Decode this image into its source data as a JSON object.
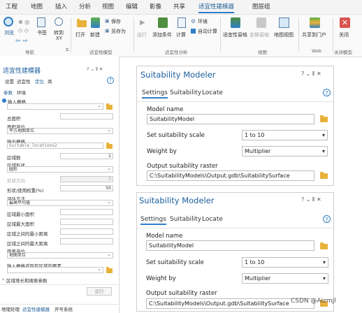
{
  "ribbon": {
    "tabs": [
      "工程",
      "地图",
      "插入",
      "分析",
      "视图",
      "编辑",
      "影像",
      "共享",
      "适宜性建模器",
      "图层组"
    ],
    "buttons": {
      "browse": "浏览",
      "bookmarks": "书签",
      "go_to_xy": "转到",
      "go_to_xy_sub": "XY",
      "open": "打开",
      "new": "新建",
      "save": "保存",
      "save_as": "另存为",
      "run": "运行",
      "add_criterion": "添加条件",
      "calculate": "计算",
      "environments": "环境",
      "auto_calculate": "自动计算",
      "suitability_pane": "适宜性窗格",
      "transform_pane": "变换窗格",
      "map_view": "地图视图",
      "share_to_portal": "共享到门户",
      "close": "关闭"
    },
    "groups": [
      "导航",
      "适宜性模型",
      "适宜性分析",
      "视图",
      "Web",
      "关闭模型"
    ]
  },
  "left_panel": {
    "title": "适宜性建模器",
    "controls": "? ⌄ ⫴ ✕",
    "tabs": [
      "设置",
      "适宜性",
      "定位",
      "商"
    ],
    "subtabs": [
      "参数",
      "环境"
    ],
    "input_raster_label": "输入栅格",
    "field_labels": {
      "total_area": "总面积",
      "area_units": "面积单位",
      "output_raster": "输出栅格",
      "num_regions": "区域数",
      "region_shape": "区域形状",
      "shape_orientation": "形状方向",
      "shape_weight": "形状/使用权重(%)",
      "evaluation_method": "评估方法",
      "min_area": "区域最小面积",
      "max_area": "区域最大面积",
      "min_distance": "区域之间的最小距离",
      "max_distance": "区域之间的最大距离",
      "distance_units": "距离单位",
      "existing_regions": "输入栅格或现有区域的要素",
      "growth_params": "区域增长和搜索参数"
    },
    "values": {
      "area_units": "平方地图单位",
      "output_raster": "Suitable_locations2",
      "num_regions": "1",
      "region_shape": "圆形",
      "shape_orientation": "0",
      "shape_weight": "50",
      "evaluation_method": "最高平均值",
      "distance_units": "地图单位"
    },
    "run_button": "运行",
    "bottom_tabs": [
      "地理处理",
      "适宜性建模器",
      "开号系统"
    ]
  },
  "dialogs": [
    {
      "title": "Suitability Modeler",
      "controls": "? ⌄ ⫴ ✕",
      "tabs": [
        "Settings",
        "Suitability",
        "Locate"
      ],
      "model_name_label": "Model name",
      "model_name": "SuitabilityModel",
      "scale_label": "Set suitability scale",
      "scale_value": "1 to 10",
      "weight_label": "Weight by",
      "weight_value": "Multiplier",
      "output_label": "Output suitability raster",
      "output_value": "C:\\SuitabilityModels\\Output.gdb\\SuitabilitySurface"
    },
    {
      "title": "Suitability Modeler",
      "controls": "? ⌄ ⫴ ✕",
      "tabs": [
        "Settings",
        "Suitability",
        "Locate"
      ],
      "model_name_label": "Model name",
      "model_name": "SuitabilityModel",
      "scale_label": "Set suitability scale",
      "scale_value": "1 to 10",
      "weight_label": "Weight by",
      "weight_value": "Multiplier",
      "output_label": "Output suitability raster",
      "output_value": "C:\\SuitabilityModels\\Output.gdb\\SuitabilitySurface"
    }
  ],
  "watermark": "CSDN @Aizmjl",
  "colors": {
    "accent": "#2e7fc6",
    "title": "#1b5f9e",
    "folder": "#e8b23a"
  }
}
